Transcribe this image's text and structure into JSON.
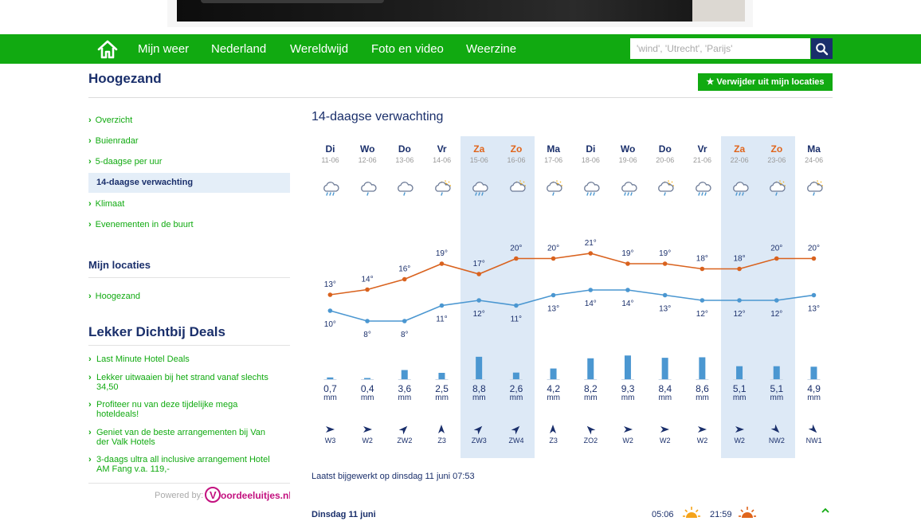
{
  "nav": {
    "items": [
      "Mijn weer",
      "Nederland",
      "Wereldwijd",
      "Foto en video",
      "Weerzine"
    ],
    "search_placeholder": "'wind', 'Utrecht', 'Parijs'"
  },
  "page_title": "Hoogezand",
  "remove_button": "★ Verwijder uit mijn locaties",
  "sidebar": {
    "items": [
      "Overzicht",
      "Buienradar",
      "5-daagse per uur",
      "14-daagse verwachting",
      "Klimaat",
      "Evenementen in de buurt"
    ],
    "active_index": 3,
    "my_locations_title": "Mijn locaties",
    "my_locations": [
      "Hoogezand"
    ],
    "deals_title": "Lekker Dichtbij Deals",
    "deals": [
      "Last Minute Hotel Deals",
      "Lekker uitwaaien bij het strand vanaf slechts 34,50",
      "Profiteer nu van deze tijdelijke mega hoteldeals!",
      "Geniet van de beste arrangementen bij Van der Valk Hotels",
      "3-daags ultra all inclusive arrangement Hotel AM Fang v.a. 119,-"
    ],
    "powered_by": "Powered by:",
    "powered_logo_text": "Voordeeluitjes.nl"
  },
  "forecast": {
    "title": "14-daagse verwachting",
    "rain_unit": "mm",
    "updated": "Laatst bijgewerkt op dinsdag 11 juni 07:53",
    "colors": {
      "max": "#d9621e",
      "min": "#4b97d1",
      "rain": "#4b97d1",
      "weekend_bg": "#dde9f6",
      "weekend_text": "#e0651c"
    },
    "days": [
      {
        "name": "Di",
        "date": "11-06",
        "weekend": false,
        "icon": "rain-icon",
        "max": 13,
        "min": 10,
        "rain": "0,7",
        "rain_mm": 0.7,
        "wind": "W3",
        "wind_dir": "W"
      },
      {
        "name": "Wo",
        "date": "12-06",
        "weekend": false,
        "icon": "light-rain-icon",
        "max": 14,
        "min": 8,
        "rain": "0,4",
        "rain_mm": 0.4,
        "wind": "W2",
        "wind_dir": "W"
      },
      {
        "name": "Do",
        "date": "13-06",
        "weekend": false,
        "icon": "light-rain-icon",
        "max": 16,
        "min": 8,
        "rain": "3,6",
        "rain_mm": 3.6,
        "wind": "ZW2",
        "wind_dir": "ZW"
      },
      {
        "name": "Vr",
        "date": "14-06",
        "weekend": false,
        "icon": "sun-rain-icon",
        "max": 19,
        "min": 11,
        "rain": "2,5",
        "rain_mm": 2.5,
        "wind": "Z3",
        "wind_dir": "Z"
      },
      {
        "name": "Za",
        "date": "15-06",
        "weekend": true,
        "icon": "rain-icon",
        "max": 17,
        "min": 12,
        "rain": "8,8",
        "rain_mm": 8.8,
        "wind": "ZW3",
        "wind_dir": "ZW"
      },
      {
        "name": "Zo",
        "date": "16-06",
        "weekend": true,
        "icon": "sun-cloud-icon",
        "max": 20,
        "min": 11,
        "rain": "2,6",
        "rain_mm": 2.6,
        "wind": "ZW4",
        "wind_dir": "ZW"
      },
      {
        "name": "Ma",
        "date": "17-06",
        "weekend": false,
        "icon": "sun-rain-icon",
        "max": 20,
        "min": 13,
        "rain": "4,2",
        "rain_mm": 4.2,
        "wind": "Z3",
        "wind_dir": "Z"
      },
      {
        "name": "Di",
        "date": "18-06",
        "weekend": false,
        "icon": "rain-icon",
        "max": 21,
        "min": 14,
        "rain": "8,2",
        "rain_mm": 8.2,
        "wind": "ZO2",
        "wind_dir": "ZO"
      },
      {
        "name": "Wo",
        "date": "19-06",
        "weekend": false,
        "icon": "rain-icon",
        "max": 19,
        "min": 14,
        "rain": "9,3",
        "rain_mm": 9.3,
        "wind": "W2",
        "wind_dir": "W"
      },
      {
        "name": "Do",
        "date": "20-06",
        "weekend": false,
        "icon": "sun-rain-icon",
        "max": 19,
        "min": 13,
        "rain": "8,4",
        "rain_mm": 8.4,
        "wind": "W2",
        "wind_dir": "W"
      },
      {
        "name": "Vr",
        "date": "21-06",
        "weekend": false,
        "icon": "rain-icon",
        "max": 18,
        "min": 12,
        "rain": "8,6",
        "rain_mm": 8.6,
        "wind": "W2",
        "wind_dir": "W"
      },
      {
        "name": "Za",
        "date": "22-06",
        "weekend": true,
        "icon": "rain-icon",
        "max": 18,
        "min": 12,
        "rain": "5,1",
        "rain_mm": 5.1,
        "wind": "W2",
        "wind_dir": "W"
      },
      {
        "name": "Zo",
        "date": "23-06",
        "weekend": true,
        "icon": "sun-rain-icon",
        "max": 20,
        "min": 12,
        "rain": "5,1",
        "rain_mm": 5.1,
        "wind": "NW2",
        "wind_dir": "NW"
      },
      {
        "name": "Ma",
        "date": "24-06",
        "weekend": false,
        "icon": "sun-rain-icon",
        "max": 20,
        "min": 13,
        "rain": "4,9",
        "rain_mm": 4.9,
        "wind": "NW1",
        "wind_dir": "NW"
      }
    ]
  },
  "day_detail": {
    "heading": "Dinsdag 11 juni",
    "sunrise": "05:06",
    "sunset": "21:59"
  }
}
